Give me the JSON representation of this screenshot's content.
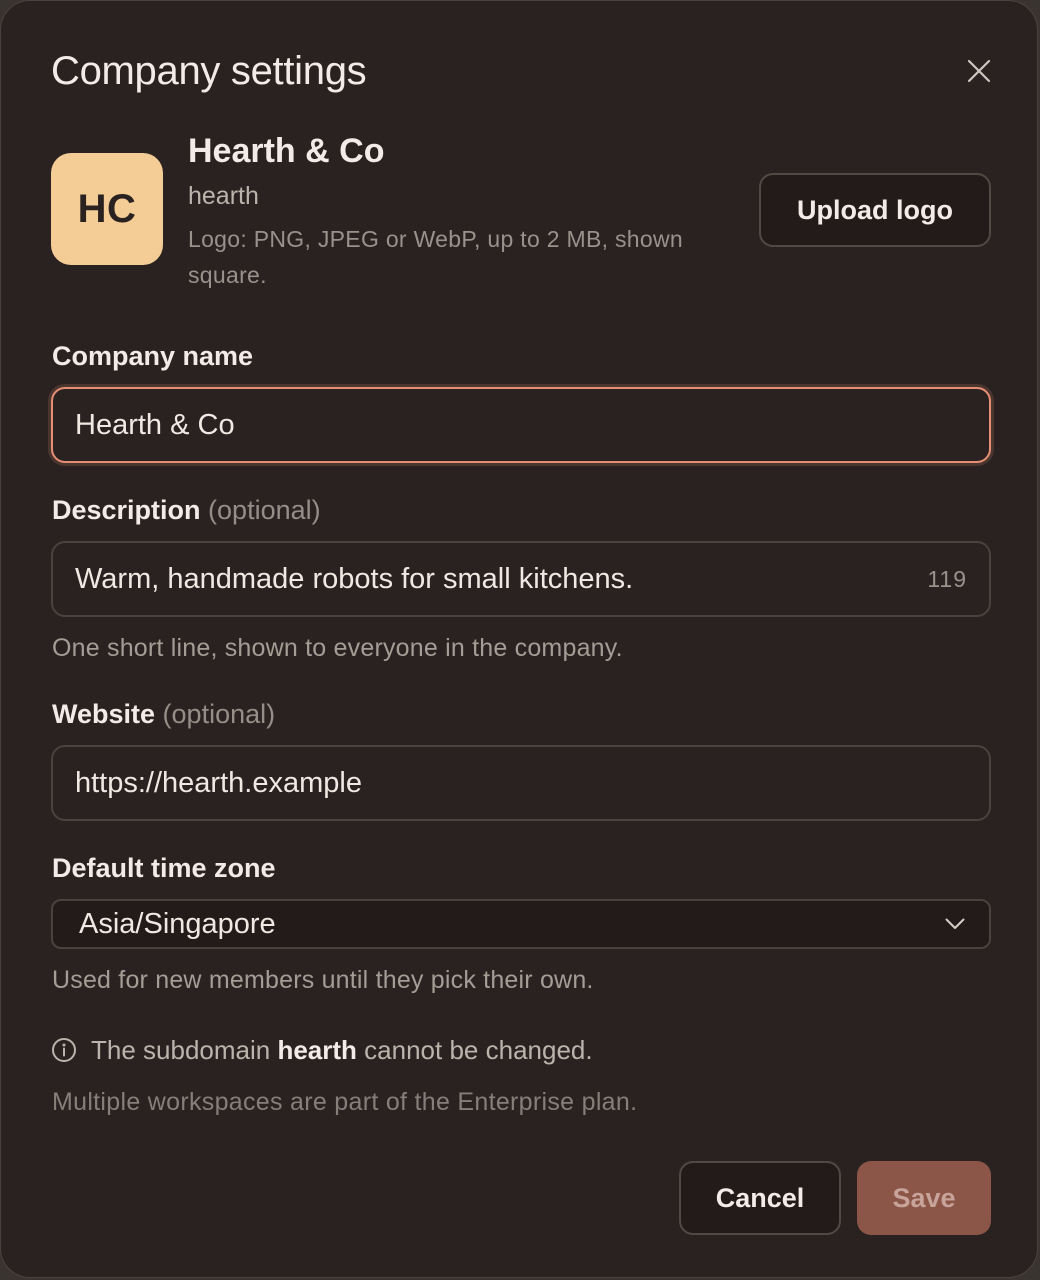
{
  "dialog": {
    "title": "Company settings",
    "close_icon": "close-icon"
  },
  "company": {
    "initials": "HC",
    "name": "Hearth & Co",
    "slug": "hearth",
    "logo_hint": "Logo: PNG, JPEG or WebP, up to 2 MB, shown square.",
    "upload_label": "Upload logo",
    "logo_color": "#f3cc96"
  },
  "form": {
    "company_name": {
      "label": "Company name",
      "value": "Hearth & Co"
    },
    "description": {
      "label": "Description",
      "optional": "(optional)",
      "value": "Warm, handmade robots for small kitchens.",
      "counter": "119",
      "help": "One short line, shown to everyone in the company."
    },
    "website": {
      "label": "Website",
      "optional": "(optional)",
      "value": "https://hearth.example"
    },
    "timezone": {
      "label": "Default time zone",
      "selected": "Asia/Singapore",
      "help": "Used for new members until they pick their own."
    }
  },
  "notes": {
    "info_prefix": "The subdomain",
    "info_bold": "hearth",
    "info_suffix": "cannot be changed.",
    "info_icon": "info-icon",
    "enterprise": "Multiple workspaces are part of the Enterprise plan."
  },
  "actions": {
    "cancel_label": "Cancel",
    "save_label": "Save"
  },
  "colors": {
    "background": "#2a2220",
    "focus_border": "#e58e74",
    "save_disabled": "#8b5648"
  }
}
